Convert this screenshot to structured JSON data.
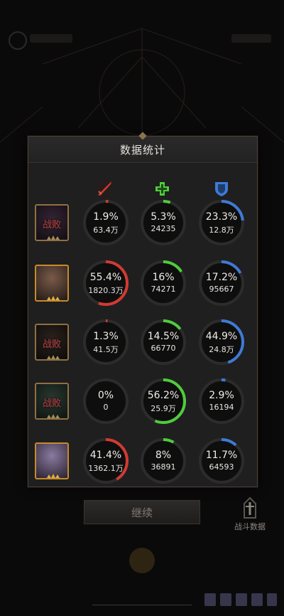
{
  "panel": {
    "title": "数据统计"
  },
  "columns": [
    {
      "icon": "sword-attack-icon",
      "color": "#d23a32"
    },
    {
      "icon": "healing-cross-icon",
      "color": "#4fcc3c"
    },
    {
      "icon": "shield-defense-icon",
      "color": "#3f7ad4"
    }
  ],
  "colors": {
    "damage": "#d23a32",
    "heal": "#4fcc3c",
    "tank": "#3f7ad4",
    "ring_track": "#0e0e0e"
  },
  "rows": [
    {
      "defeated": true,
      "defeat_label": "战败",
      "stats": [
        {
          "pct": 1.9,
          "pct_label": "1.9%",
          "value": "63.4万"
        },
        {
          "pct": 5.3,
          "pct_label": "5.3%",
          "value": "24235"
        },
        {
          "pct": 23.3,
          "pct_label": "23.3%",
          "value": "12.8万"
        }
      ]
    },
    {
      "defeated": false,
      "defeat_label": "",
      "stats": [
        {
          "pct": 55.4,
          "pct_label": "55.4%",
          "value": "1820.3万"
        },
        {
          "pct": 16,
          "pct_label": "16%",
          "value": "74271"
        },
        {
          "pct": 17.2,
          "pct_label": "17.2%",
          "value": "95667"
        }
      ]
    },
    {
      "defeated": true,
      "defeat_label": "战败",
      "stats": [
        {
          "pct": 1.3,
          "pct_label": "1.3%",
          "value": "41.5万"
        },
        {
          "pct": 14.5,
          "pct_label": "14.5%",
          "value": "66770"
        },
        {
          "pct": 44.9,
          "pct_label": "44.9%",
          "value": "24.8万"
        }
      ]
    },
    {
      "defeated": true,
      "defeat_label": "战败",
      "stats": [
        {
          "pct": 0,
          "pct_label": "0%",
          "value": "0"
        },
        {
          "pct": 56.2,
          "pct_label": "56.2%",
          "value": "25.9万"
        },
        {
          "pct": 2.9,
          "pct_label": "2.9%",
          "value": "16194"
        }
      ]
    },
    {
      "defeated": false,
      "defeat_label": "",
      "stats": [
        {
          "pct": 41.4,
          "pct_label": "41.4%",
          "value": "1362.1万"
        },
        {
          "pct": 8,
          "pct_label": "8%",
          "value": "36891"
        },
        {
          "pct": 11.7,
          "pct_label": "11.7%",
          "value": "64593"
        }
      ]
    }
  ],
  "footer": {
    "continue_label": "继续",
    "battle_data_label": "战斗数据"
  }
}
